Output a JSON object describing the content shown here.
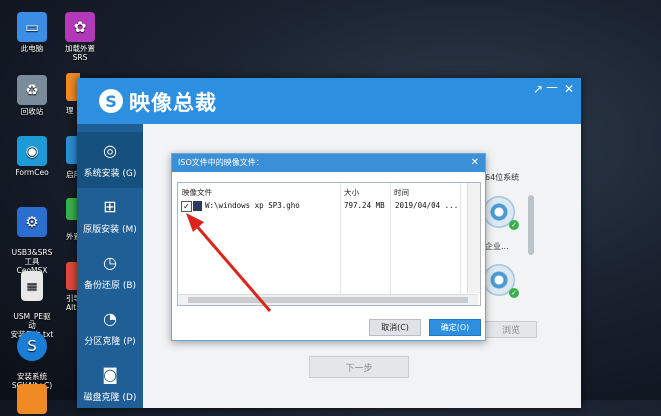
{
  "desktop": {
    "icons": [
      {
        "label": "此电脑",
        "icon": "computer-icon",
        "color": "#3a8ee6"
      },
      {
        "label": "加载外置SRS",
        "icon": "srs-icon",
        "color": "#b23ab8"
      },
      {
        "label": "回收站",
        "icon": "recycle-bin-icon",
        "color": "#7a8b99"
      },
      {
        "label": "FormCeo",
        "icon": "formceo-icon",
        "color": "#1e9bd7"
      },
      {
        "label": "USB3&SRS\n工具CeoMSX",
        "icon": "usb-tool-icon",
        "color": "#2a6fd0"
      },
      {
        "label": "USM_PE驱动\n安装日志.txt",
        "icon": "text-file-icon",
        "color": "#e8e8e8"
      },
      {
        "label": "安装系统\nSGI(Alt+C)",
        "icon": "install-system-icon",
        "color": "#1a7fd4"
      },
      {
        "label": "",
        "icon": "app-icon",
        "color": "#f08a24"
      }
    ],
    "peek_labels": [
      "理",
      "启用",
      "外置",
      "引导\nAlt"
    ]
  },
  "window": {
    "title": "映像总裁",
    "logo_char": "S",
    "controls": [
      "↗",
      "—",
      "✕"
    ],
    "sidebar": [
      {
        "label": "系统安装 (G)",
        "icon": "globe-icon"
      },
      {
        "label": "原版安装 (M)",
        "icon": "windows-icon"
      },
      {
        "label": "备份还原 (B)",
        "icon": "history-icon"
      },
      {
        "label": "分区克隆 (P)",
        "icon": "pie-icon"
      },
      {
        "label": "磁盘克隆 (D)",
        "icon": "disk-icon"
      }
    ],
    "right_labels": [
      "64位系统",
      "企业..."
    ],
    "browse_label": "浏览",
    "next_label": "下一步"
  },
  "dialog": {
    "title": "ISO文件中的映像文件：",
    "close": "✕",
    "columns": [
      "映像文件",
      "大小",
      "时间"
    ],
    "rows": [
      {
        "checked": "✓",
        "file": "W:\\windows xp SP3.gho",
        "size": "797.24 MB",
        "time": "2019/04/04 ..."
      }
    ],
    "cancel_label": "取消(C)",
    "ok_label": "确定(O)"
  },
  "colors": {
    "accent": "#2d8fe0",
    "sidebar": "#1f5f96",
    "arrow": "#d9251c"
  }
}
